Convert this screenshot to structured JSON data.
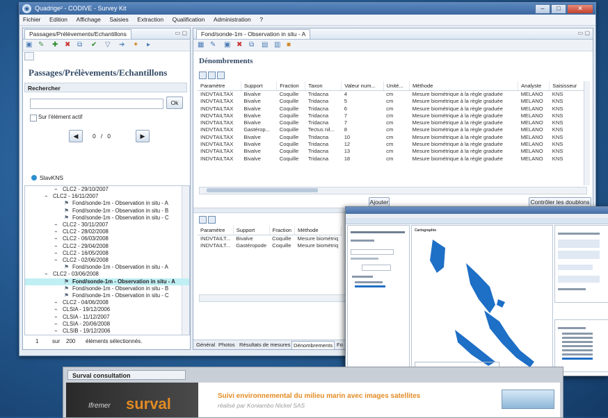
{
  "window": {
    "title": "Quadrige² - CODIVE - Survey Kit",
    "controls": [
      "–",
      "□",
      "✕"
    ]
  },
  "menu": [
    "Fichier",
    "Edition",
    "Affichage",
    "Saisies",
    "Extraction",
    "Qualification",
    "Administration",
    "?"
  ],
  "left_panel": {
    "tab": "Passages/Prélèvements/Echantillons",
    "title": "Passages/Prélèvements/Echantillons",
    "search_header": "Rechercher",
    "ok": "Ok",
    "active_checkbox": "Sur l'élément actif",
    "pager": {
      "current": "0",
      "sep": "/",
      "total": "0"
    },
    "user": "SlavKNS",
    "tree": [
      {
        "label": "CLC2 - 29/10/2007",
        "indent": 3,
        "sel": false
      },
      {
        "label": "CLC2 - 16/11/2007",
        "indent": 2,
        "sel": false
      },
      {
        "label": "Fond/sonde-1m - Observation in situ - A",
        "indent": 4,
        "sel": false
      },
      {
        "label": "Fond/sonde-1m - Observation in situ - B",
        "indent": 4,
        "sel": false
      },
      {
        "label": "Fond/sonde-1m - Observation in situ - C",
        "indent": 4,
        "sel": false
      },
      {
        "label": "CLC2 - 30/11/2007",
        "indent": 3,
        "sel": false
      },
      {
        "label": "CLC2 - 28/02/2008",
        "indent": 3,
        "sel": false
      },
      {
        "label": "CLC2 - 06/03/2008",
        "indent": 3,
        "sel": false
      },
      {
        "label": "CLC2 - 29/04/2008",
        "indent": 3,
        "sel": false
      },
      {
        "label": "CLC2 - 16/05/2008",
        "indent": 3,
        "sel": false
      },
      {
        "label": "CLC2 - 02/06/2008",
        "indent": 3,
        "sel": false
      },
      {
        "label": "Fond/sonde-1m - Observation in situ - A",
        "indent": 4,
        "sel": false
      },
      {
        "label": "CLC2 - 03/06/2008",
        "indent": 2,
        "sel": false
      },
      {
        "label": "Fond/sonde-1m - Observation in situ - A",
        "indent": 4,
        "sel": true
      },
      {
        "label": "Fond/sonde-1m - Observation in situ - B",
        "indent": 4,
        "sel": false
      },
      {
        "label": "Fond/sonde-1m - Observation in situ - C",
        "indent": 4,
        "sel": false
      },
      {
        "label": "CLC2 - 04/06/2008",
        "indent": 3,
        "sel": false
      },
      {
        "label": "CLSIA - 19/12/2006",
        "indent": 3,
        "sel": false
      },
      {
        "label": "CLSIA - 11/12/2007",
        "indent": 3,
        "sel": false
      },
      {
        "label": "CLSIA - 20/06/2008",
        "indent": 3,
        "sel": false
      },
      {
        "label": "CLSIB - 19/12/2006",
        "indent": 3,
        "sel": false
      }
    ],
    "status": {
      "count": "1",
      "sur": "sur",
      "total": "200",
      "label": "éléments sélectionnés."
    }
  },
  "right_panel": {
    "tab": "Fond/sonde-1m - Observation in situ - A",
    "title": "Dénombrements",
    "columns": [
      "Paramètre",
      "Support",
      "Fraction",
      "Taxon",
      "Valeur num...",
      "Unité...",
      "Méthode",
      "Analyste",
      "Saisisseur"
    ],
    "rows": [
      [
        "INDVTAILTAX",
        "Bivalve",
        "Coquille",
        "Tridacna",
        "4",
        "cm",
        "Mesure biométrique à la règle graduée",
        "MELANO",
        "KNS"
      ],
      [
        "INDVTAILTAX",
        "Bivalve",
        "Coquille",
        "Tridacna",
        "5",
        "cm",
        "Mesure biométrique à la règle graduée",
        "MELANO",
        "KNS"
      ],
      [
        "INDVTAILTAX",
        "Bivalve",
        "Coquille",
        "Tridacna",
        "6",
        "cm",
        "Mesure biométrique à la règle graduée",
        "MELANO",
        "KNS"
      ],
      [
        "INDVTAILTAX",
        "Bivalve",
        "Coquille",
        "Tridacna",
        "7",
        "cm",
        "Mesure biométrique à la règle graduée",
        "MELANO",
        "KNS"
      ],
      [
        "INDVTAILTAX",
        "Bivalve",
        "Coquille",
        "Tridacna",
        "7",
        "cm",
        "Mesure biométrique à la règle graduée",
        "MELANO",
        "KNS"
      ],
      [
        "INDVTAILTAX",
        "Gastérop...",
        "Coquille",
        "Tectus nil...",
        "8",
        "cm",
        "Mesure biométrique à la règle graduée",
        "MELANO",
        "KNS"
      ],
      [
        "INDVTAILTAX",
        "Bivalve",
        "Coquille",
        "Tridacna",
        "10",
        "cm",
        "Mesure biométrique à la règle graduée",
        "MELANO",
        "KNS"
      ],
      [
        "INDVTAILTAX",
        "Bivalve",
        "Coquille",
        "Tridacna",
        "12",
        "cm",
        "Mesure biométrique à la règle graduée",
        "MELANO",
        "KNS"
      ],
      [
        "INDVTAILTAX",
        "Bivalve",
        "Coquille",
        "Tridacna",
        "13",
        "cm",
        "Mesure biométrique à la règle graduée",
        "MELANO",
        "KNS"
      ],
      [
        "INDVTAILTAX",
        "Bivalve",
        "Coquille",
        "Tridacna",
        "18",
        "cm",
        "Mesure biométrique à la règle graduée",
        "MELANO",
        "KNS"
      ]
    ],
    "add_button": "Ajouter",
    "check_button": "Contrôler les doublons",
    "columns2": [
      "Paramètre",
      "Support",
      "Fraction",
      "Méthode"
    ],
    "rows2": [
      [
        "INDVTAILT...",
        "Bivalve",
        "Coquille",
        "Mesure biométriq"
      ],
      [
        "INDVTAILT...",
        "Gastéropode",
        "Coquille",
        "Mesure biométriq"
      ]
    ],
    "bottom_tabs": [
      "Général",
      "Photos",
      "Résultats de mesures",
      "Dénombrements",
      "Fo"
    ]
  },
  "overlay": {
    "label": "Cartographie"
  },
  "browser": {
    "tab": "Surval consultation",
    "logo_brand": "Ifremer",
    "logo_text": "surval",
    "title": "Suivi environnemental du milieu marin avec images satellites",
    "subtitle": "réalisé par Koniambo Nickel SAS"
  },
  "colors": {
    "accent": "#2d6fb8",
    "selection": "#bfeff3",
    "map_water": "#1e6fc6",
    "survey_orange": "#e38b24"
  }
}
